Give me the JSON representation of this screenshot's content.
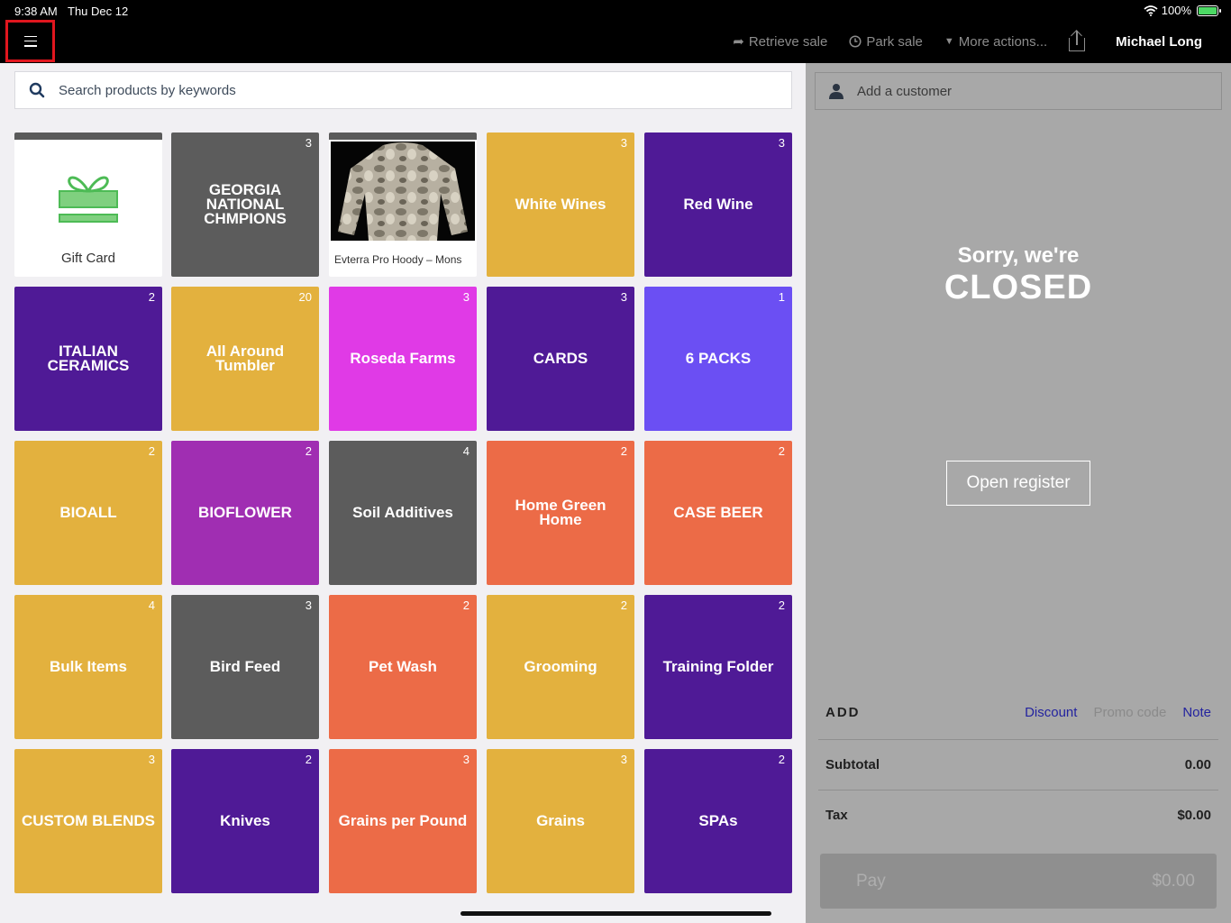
{
  "status_bar": {
    "time": "9:38 AM",
    "date": "Thu Dec 12",
    "battery": "100%"
  },
  "header": {
    "retrieve_sale": "Retrieve sale",
    "park_sale": "Park sale",
    "more_actions": "More actions...",
    "user": "Michael Long"
  },
  "search": {
    "placeholder": "Search products by keywords"
  },
  "tiles": [
    {
      "label": "Gift Card",
      "count": "",
      "color": "#ffffff"
    },
    {
      "label": "GEORGIA NATIONAL CHMPIONS",
      "count": "3",
      "color": "#5c5c5c"
    },
    {
      "label": "Evterra Pro Hoody – Mons",
      "count": "",
      "color": "#ffffff"
    },
    {
      "label": "White Wines",
      "count": "3",
      "color": "#e3b13e"
    },
    {
      "label": "Red Wine",
      "count": "3",
      "color": "#4f1a96"
    },
    {
      "label": "ITALIAN CERAMICS",
      "count": "2",
      "color": "#4f1a96"
    },
    {
      "label": "All Around Tumbler",
      "count": "20",
      "color": "#e3b13e"
    },
    {
      "label": "Roseda Farms",
      "count": "3",
      "color": "#e03ae6"
    },
    {
      "label": "CARDS",
      "count": "3",
      "color": "#4f1a96"
    },
    {
      "label": "6 PACKS",
      "count": "1",
      "color": "#6b4ff3"
    },
    {
      "label": "BIOALL",
      "count": "2",
      "color": "#e3b13e"
    },
    {
      "label": "BIOFLOWER",
      "count": "2",
      "color": "#a02eb2"
    },
    {
      "label": "Soil Additives",
      "count": "4",
      "color": "#5c5c5c"
    },
    {
      "label": "Home Green Home",
      "count": "2",
      "color": "#ec6b47"
    },
    {
      "label": "CASE BEER",
      "count": "2",
      "color": "#ec6b47"
    },
    {
      "label": "Bulk Items",
      "count": "4",
      "color": "#e3b13e"
    },
    {
      "label": "Bird Feed",
      "count": "3",
      "color": "#5c5c5c"
    },
    {
      "label": "Pet Wash",
      "count": "2",
      "color": "#ec6b47"
    },
    {
      "label": "Grooming",
      "count": "2",
      "color": "#e3b13e"
    },
    {
      "label": "Training Folder",
      "count": "2",
      "color": "#4f1a96"
    },
    {
      "label": "CUSTOM BLENDS",
      "count": "3",
      "color": "#e3b13e"
    },
    {
      "label": "Knives",
      "count": "2",
      "color": "#4f1a96"
    },
    {
      "label": "Grains per Pound",
      "count": "3",
      "color": "#ec6b47"
    },
    {
      "label": "Grains",
      "count": "3",
      "color": "#e3b13e"
    },
    {
      "label": "SPAs",
      "count": "2",
      "color": "#4f1a96"
    }
  ],
  "sale": {
    "add_customer": "Add a customer",
    "closed_line1": "Sorry, we're",
    "closed_line2": "CLOSED",
    "open_register": "Open register",
    "add_label": "ADD",
    "discount": "Discount",
    "promo_code": "Promo code",
    "note": "Note",
    "subtotal_label": "Subtotal",
    "subtotal_value": "0.00",
    "tax_label": "Tax",
    "tax_value": "$0.00",
    "pay_label": "Pay",
    "pay_value": "$0.00"
  }
}
